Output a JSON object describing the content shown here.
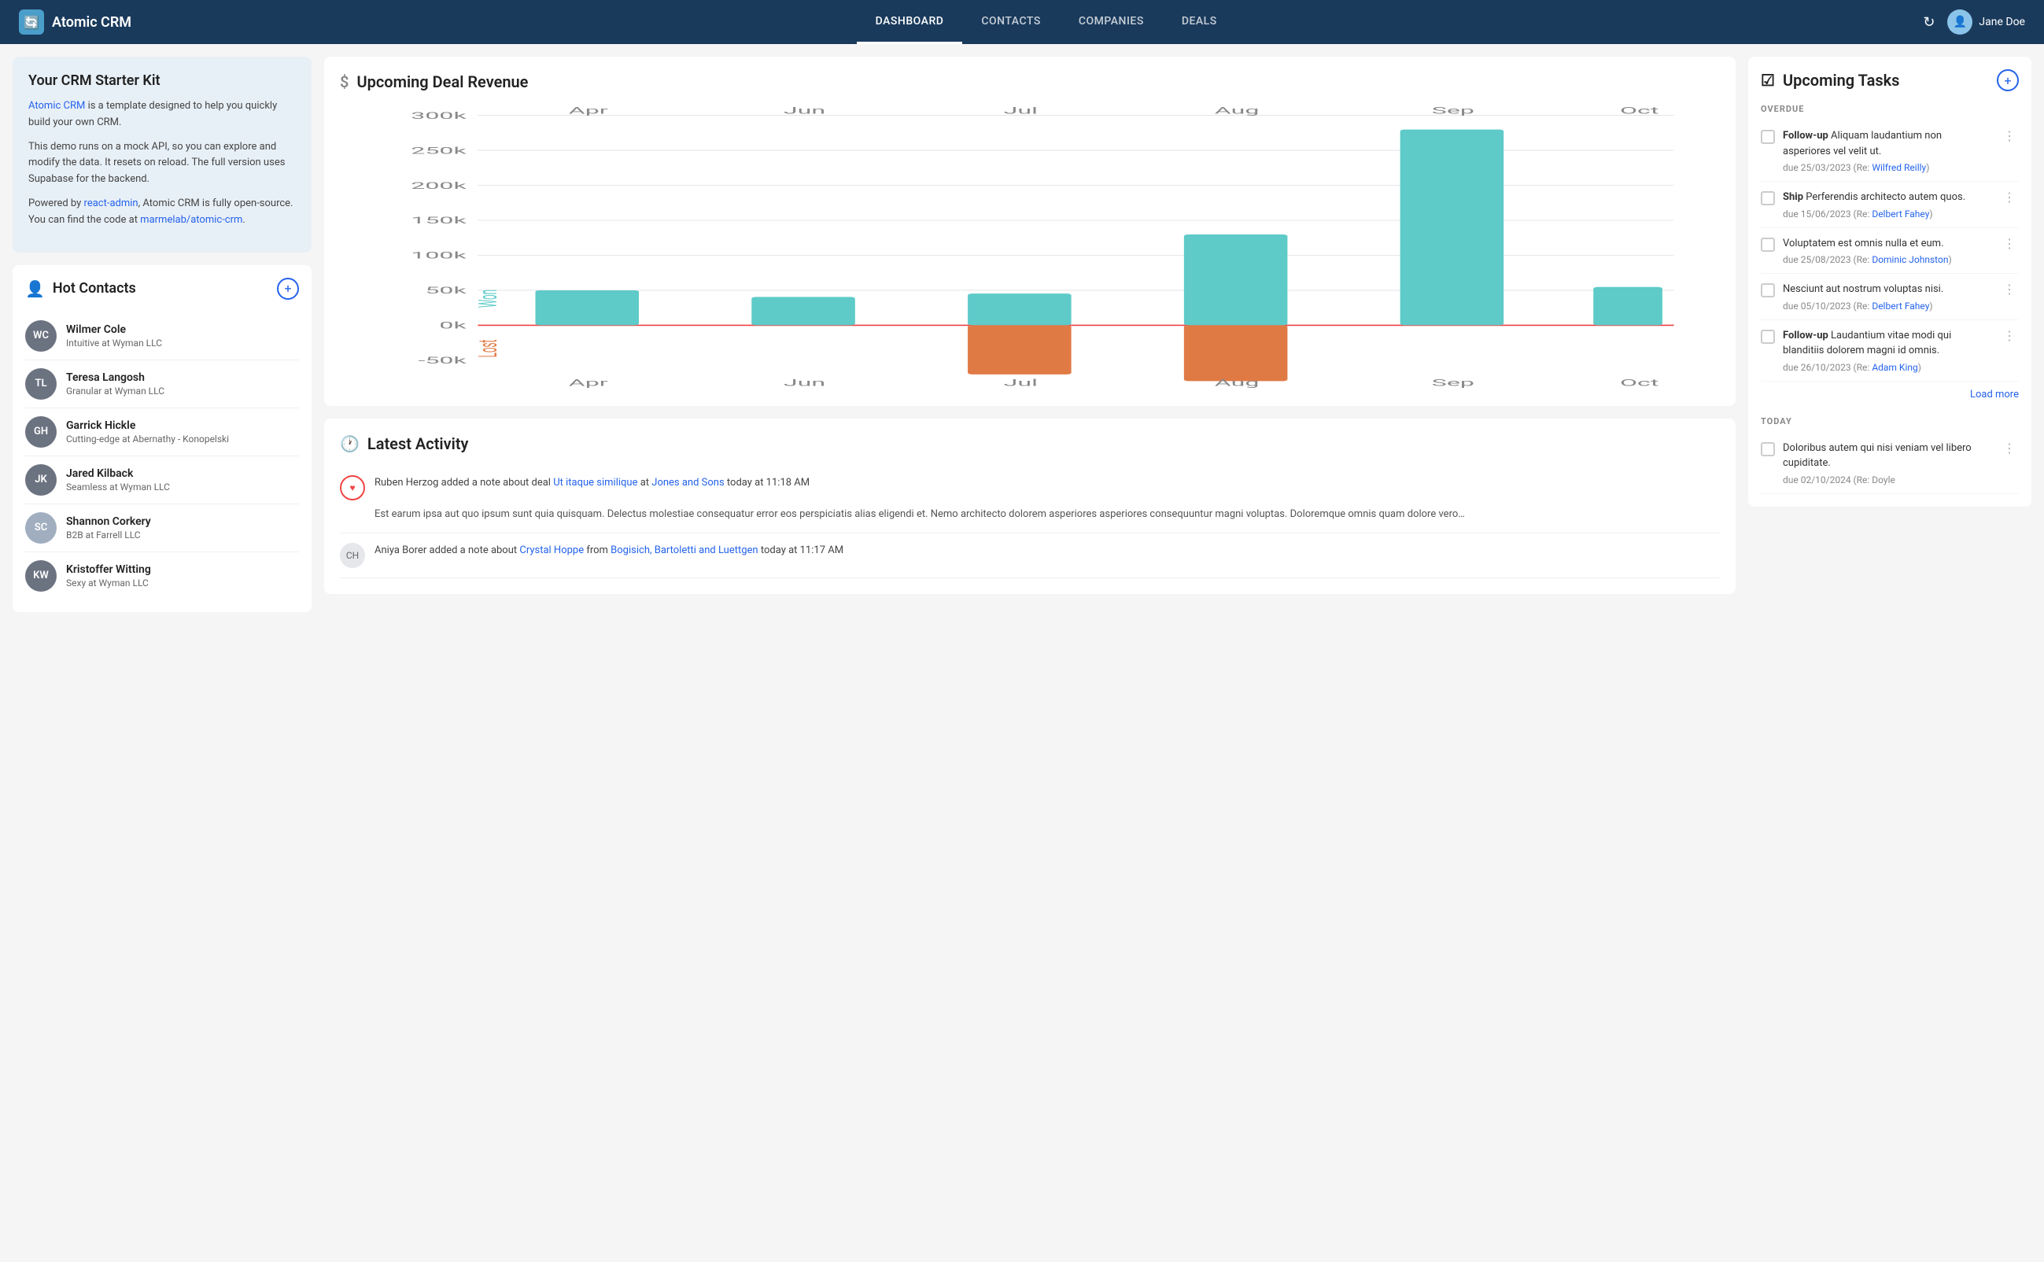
{
  "header": {
    "logo_text": "Atomic CRM",
    "nav": [
      {
        "label": "DASHBOARD",
        "active": true
      },
      {
        "label": "CONTACTS",
        "active": false
      },
      {
        "label": "COMPANIES",
        "active": false
      },
      {
        "label": "DEALS",
        "active": false
      }
    ],
    "user_name": "Jane Doe"
  },
  "starter_kit": {
    "title": "Your CRM Starter Kit",
    "p1_prefix": " is a template designed to help you quickly build your own CRM.",
    "p1_link_text": "Atomic CRM",
    "p1_link_url": "#",
    "p2": "This demo runs on a mock API, so you can explore and modify the data. It resets on reload. The full version uses Supabase for the backend.",
    "p3_prefix": "Powered by ",
    "p3_link1_text": "react-admin",
    "p3_link1_url": "#",
    "p3_middle": ", Atomic CRM is fully open-source. You can find the code at ",
    "p3_link2_text": "marmelab/atomic-crm",
    "p3_link2_url": "#",
    "p3_suffix": "."
  },
  "hot_contacts": {
    "title": "Hot Contacts",
    "contacts": [
      {
        "initials": "WC",
        "name": "Wilmer Cole",
        "company": "Intuitive at Wyman LLC",
        "has_photo": false,
        "bg": "#6b7280"
      },
      {
        "initials": "TL",
        "name": "Teresa Langosh",
        "company": "Granular at Wyman LLC",
        "has_photo": false,
        "bg": "#6b7280"
      },
      {
        "initials": "GH",
        "name": "Garrick Hickle",
        "company": "Cutting-edge at Abernathy - Konopelski",
        "has_photo": false,
        "bg": "#6b7280"
      },
      {
        "initials": "JK",
        "name": "Jared Kilback",
        "company": "Seamless at Wyman LLC",
        "has_photo": false,
        "bg": "#6b7280"
      },
      {
        "initials": "SC",
        "name": "Shannon Corkery",
        "company": "B2B at Farrell LLC",
        "has_photo": true,
        "bg": "#9ca3af"
      },
      {
        "initials": "KW",
        "name": "Kristoffer Witting",
        "company": "Sexy at Wyman LLC",
        "has_photo": false,
        "bg": "#6b7280"
      }
    ]
  },
  "chart": {
    "title": "Upcoming Deal Revenue",
    "labels": [
      "Apr",
      "Jun",
      "Jul",
      "Aug",
      "Sep",
      "Oct"
    ],
    "y_labels": [
      "300k",
      "250k",
      "200k",
      "150k",
      "100k",
      "50k",
      "0k",
      "-50k"
    ],
    "won_bars": [
      {
        "month": "Apr",
        "value": 50000
      },
      {
        "month": "Jun",
        "value": 40000
      },
      {
        "month": "Jul",
        "value": 45000
      },
      {
        "month": "Aug",
        "value": 130000
      },
      {
        "month": "Sep",
        "value": 280000
      },
      {
        "month": "Oct",
        "value": 55000
      }
    ],
    "lost_bars": [
      {
        "month": "Jul",
        "value": -70000
      },
      {
        "month": "Aug",
        "value": -80000
      }
    ],
    "won_label": "Won",
    "lost_label": "Lost"
  },
  "activity": {
    "title": "Latest Activity",
    "items": [
      {
        "type": "heart",
        "text_prefix": "Ruben Herzog added a note about deal ",
        "deal_link_text": "Ut itaque similique",
        "deal_link_url": "#",
        "text_middle": " at ",
        "company_link_text": "Jones and Sons",
        "company_link_url": "#",
        "time": "today at 11:18 AM",
        "body": "Est earum ipsa aut quo ipsum sunt quia quisquam. Delectus molestiae consequatur error eos perspiciatis alias eligendi et. Nemo architecto dolorem asperiores asperiores consequuntur magni voluptas. Doloremque omnis quam dolore vero…"
      },
      {
        "type": "avatar",
        "initials": "CH",
        "text_prefix": "Aniya Borer added a note about ",
        "contact_link_text": "Crystal Hoppe",
        "contact_link_url": "#",
        "text_middle": " from ",
        "company_link_text": "Bogisich, Bartoletti and Luettgen",
        "company_link_url": "#",
        "time": "today at 11:17 AM",
        "body": ""
      }
    ]
  },
  "tasks": {
    "title": "Upcoming Tasks",
    "overdue_label": "OVERDUE",
    "today_label": "TODAY",
    "load_more_label": "Load more",
    "overdue_tasks": [
      {
        "id": 1,
        "text_prefix": "",
        "bold": "Follow-up",
        "text": " Aliquam laudantium non asperiores vel velit ut.",
        "due": "due 25/03/2023 (Re: ",
        "person_link": "Wilfred Reilly",
        "person_url": "#",
        "due_suffix": ")"
      },
      {
        "id": 2,
        "bold": "Ship",
        "text": " Perferendis architecto autem quos.",
        "due": "due 15/06/2023 (Re: ",
        "person_link": "Delbert Fahey",
        "person_url": "#",
        "due_suffix": ")"
      },
      {
        "id": 3,
        "bold": "",
        "text": "Voluptatem est omnis nulla et eum.",
        "due": "due 25/08/2023 (Re: ",
        "person_link": "Dominic Johnston",
        "person_url": "#",
        "due_suffix": ")"
      },
      {
        "id": 4,
        "bold": "",
        "text": "Nesciunt aut nostrum voluptas nisi.",
        "due": "due 05/10/2023 (Re: ",
        "person_link": "Delbert Fahey",
        "person_url": "#",
        "due_suffix": ")"
      },
      {
        "id": 5,
        "bold": "Follow-up",
        "text": " Laudantium vitae modi qui blanditiis dolorem magni id omnis.",
        "due": "due 26/10/2023 (Re: ",
        "person_link": "Adam King",
        "person_url": "#",
        "due_suffix": ")"
      }
    ],
    "today_tasks": [
      {
        "id": 6,
        "bold": "",
        "text": "Doloribus autem qui nisi veniam vel libero cupiditate.",
        "due": "due 02/10/2024 (Re: Doyle",
        "person_link": "",
        "person_url": "#",
        "due_suffix": ""
      }
    ]
  }
}
